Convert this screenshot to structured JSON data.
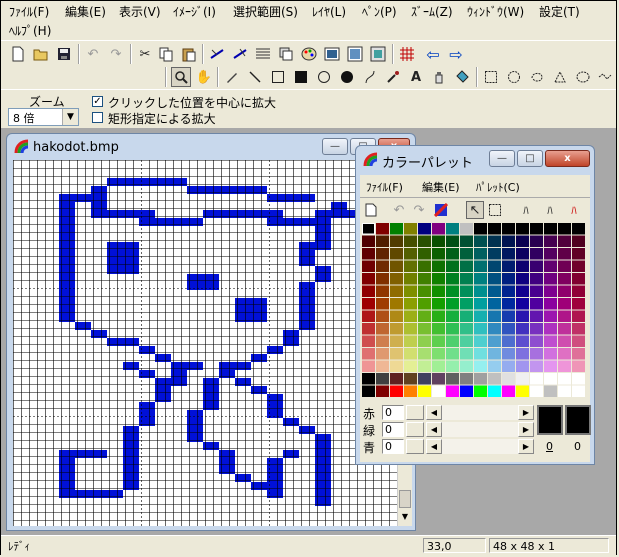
{
  "menubar": {
    "items": [
      "ﾌｧｲﾙ(F)",
      "編集(E)",
      "表示(V)",
      "ｲﾒｰｼﾞ(I)",
      "選択範囲(S)",
      "ﾚｲﾔ(L)",
      "ﾍﾟﾝ(P)",
      "ｽﾞｰﾑ(Z)",
      "ｳｨﾝﾄﾞｳ(W)",
      "設定(T)"
    ],
    "help": "ﾍﾙﾌﾟ(H)"
  },
  "toolbar": {
    "file_icons": [
      "new-file-icon",
      "open-folder-icon",
      "save-icon",
      "undo-icon",
      "redo-icon",
      "cut-icon",
      "copy-icon",
      "paste-icon",
      "flip-horizontal-icon",
      "flip-vertical-icon",
      "grid-icon",
      "layer-icon",
      "palette-icon",
      "preview-icon",
      "image-window-icon",
      "grid-toggle-icon",
      "prev-icon",
      "next-icon"
    ],
    "tool_icons": [
      "zoom-tool-icon",
      "hand-tool-icon",
      "pen-tool-icon",
      "line-tool-icon",
      "rect-tool-icon",
      "filled-rect-tool-icon",
      "ellipse-tool-icon",
      "filled-ellipse-tool-icon",
      "curve-tool-icon",
      "eyedropper-tool-icon",
      "text-tool-icon",
      "spray-tool-icon",
      "fill-tool-icon",
      "rect-select-icon",
      "ellipse-select-icon",
      "lasso-select-icon",
      "polygon-select-icon",
      "magic-wand-icon"
    ]
  },
  "options": {
    "zoom_label": "ズーム",
    "zoom_value": "8 倍",
    "center_zoom_label": "クリックした位置を中心に拡大",
    "center_zoom_checked": true,
    "rect_zoom_label": "矩形指定による拡大",
    "rect_zoom_checked": false
  },
  "image_window": {
    "title": "hakodot.bmp",
    "min": "—",
    "max": "□",
    "close": "x"
  },
  "pixel_art": {
    "cols": 48,
    "rows": 48,
    "color": "#0010d8",
    "rows_data": [
      "........................",
      "........................",
      "......#####.............",
      ".....#.....#####........",
      "...###..........###.....",
      "...#.#..............#...",
      "...#.####...#####..###..",
      "...#....####....####....",
      "...#...............#....",
      "...#...............#....",
      "...#..##..........##....",
      "...#..##..........#.....",
      "...#..##..........#.....",
      "...#..##...........#....",
      "...#.......##......#....",
      "...#.......##.....#.....",
      "...#..............#.....",
      "...#..........##..#.....",
      "...#..........##..#.....",
      "...#..........##..#.....",
      "....#.............#.....",
      ".....#...........#......",
      "......##.........#......",
      "........#.......#.......",
      ".........#.....#........",
      ".......#..##.##.........",
      "........#.#..#..........",
      ".........##.#.#.........",
      ".........#..#..#........",
      ".........#..#...#.......",
      "........#...#...#.......",
      "........#..#....#.......",
      "........#..#.....#......",
      ".......#...#......#.....",
      ".......#...#.......#....",
      ".......#....#......#....",
      "...###.#.....#...#.#....",
      "...#...#.....#..#..#....",
      "...#...#.....#..#..#....",
      "...#...#......#.#..#....",
      "...#...#.......##..#....",
      "...####.........#..#....",
      "...................#....",
      "........................"
    ]
  },
  "palette_window": {
    "title": "カラーパレット",
    "menu": [
      "ﾌｧｲﾙ(F)",
      "編集(E)",
      "ﾊﾟﾚｯﾄ(C)"
    ],
    "icons": [
      "new-palette-icon",
      "undo-icon",
      "redo-icon",
      "swap-colors-icon",
      "pointer-icon",
      "select-icon",
      "gradient-a-icon",
      "gradient-b-icon",
      "gradient-c-icon"
    ],
    "sliders": [
      {
        "label": "赤",
        "value": "0"
      },
      {
        "label": "緑",
        "value": "0"
      },
      {
        "label": "青",
        "value": "0"
      }
    ],
    "fg_index": "0",
    "bg_index": "0",
    "fg_color": "#000000",
    "bg_color": "#000000"
  },
  "status": {
    "text": "ﾚﾃﾞｨ",
    "coords": "33,0",
    "size": "48 x 48 x 1"
  }
}
